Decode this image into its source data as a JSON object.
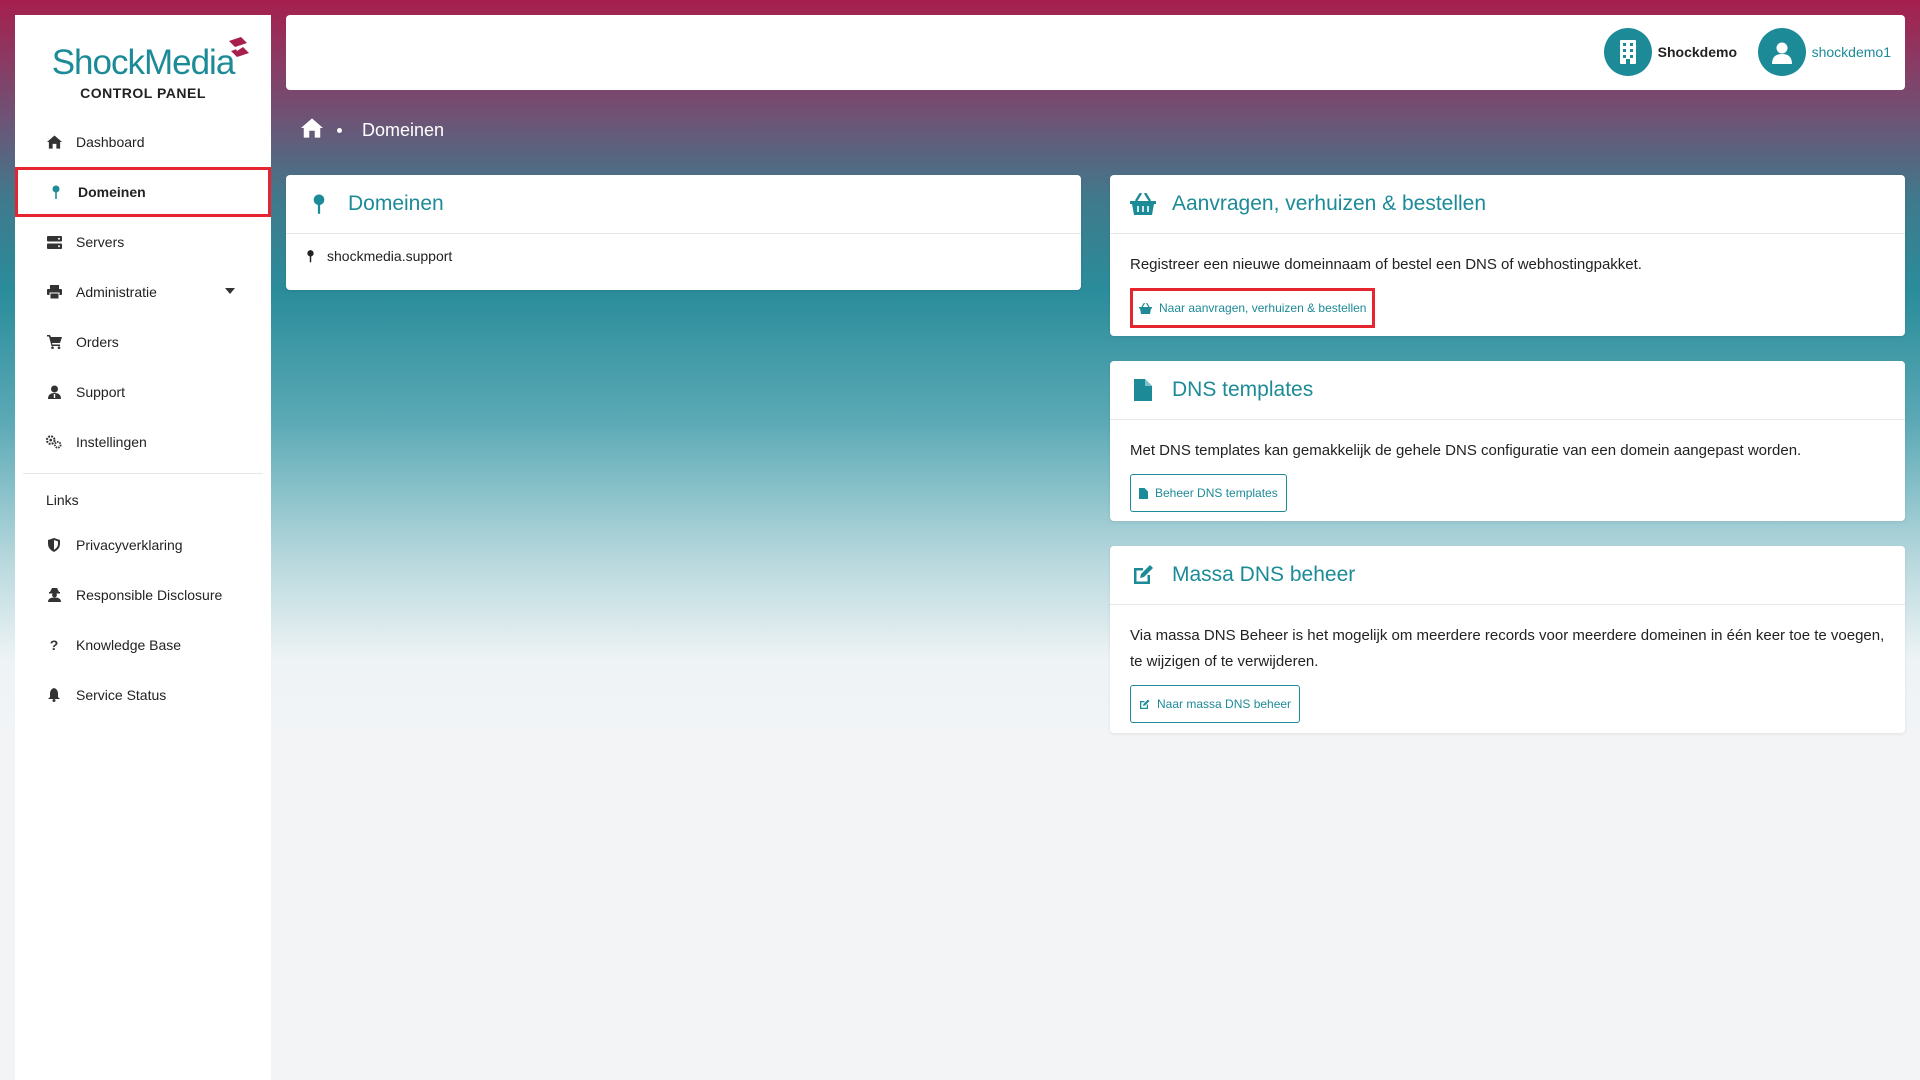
{
  "brand": {
    "name_part1": "Shock",
    "name_part2": "Media",
    "subtitle": "CONTROL PANEL"
  },
  "sidebar": {
    "items": [
      {
        "label": "Dashboard",
        "icon": "home-icon"
      },
      {
        "label": "Domeinen",
        "icon": "pin-icon",
        "active": true
      },
      {
        "label": "Servers",
        "icon": "server-icon"
      },
      {
        "label": "Administratie",
        "icon": "printer-icon",
        "has_dropdown": true
      },
      {
        "label": "Orders",
        "icon": "cart-icon"
      },
      {
        "label": "Support",
        "icon": "support-user-icon"
      },
      {
        "label": "Instellingen",
        "icon": "cogs-icon"
      }
    ],
    "links_label": "Links",
    "links": [
      {
        "label": "Privacyverklaring",
        "icon": "shield-icon"
      },
      {
        "label": "Responsible Disclosure",
        "icon": "user-secret-icon"
      },
      {
        "label": "Knowledge Base",
        "icon": "question-icon"
      },
      {
        "label": "Service Status",
        "icon": "bell-icon"
      }
    ]
  },
  "topbar": {
    "company": "Shockdemo",
    "user": "shockdemo1"
  },
  "breadcrumb": {
    "current": "Domeinen"
  },
  "domains_card": {
    "title": "Domeinen",
    "domains": [
      "shockmedia.support"
    ]
  },
  "order_card": {
    "title": "Aanvragen, verhuizen & bestellen",
    "text": "Registreer een nieuwe domeinnaam of bestel een DNS of webhostingpakket.",
    "button": "Naar aanvragen, verhuizen & bestellen"
  },
  "dns_card": {
    "title": "DNS templates",
    "text": "Met DNS templates kan gemakkelijk de gehele DNS configuratie van een domein aangepast worden.",
    "button": "Beheer DNS templates"
  },
  "mass_card": {
    "title": "Massa DNS beheer",
    "text": "Via massa DNS Beheer is het mogelijk om meerdere records voor meerdere domeinen in één keer toe te voegen, te wijzigen of te verwijderen.",
    "button": "Naar massa DNS beheer"
  },
  "colors": {
    "accent": "#1d8b97",
    "brand_red": "#a61f4d",
    "highlight": "#e5262f"
  }
}
